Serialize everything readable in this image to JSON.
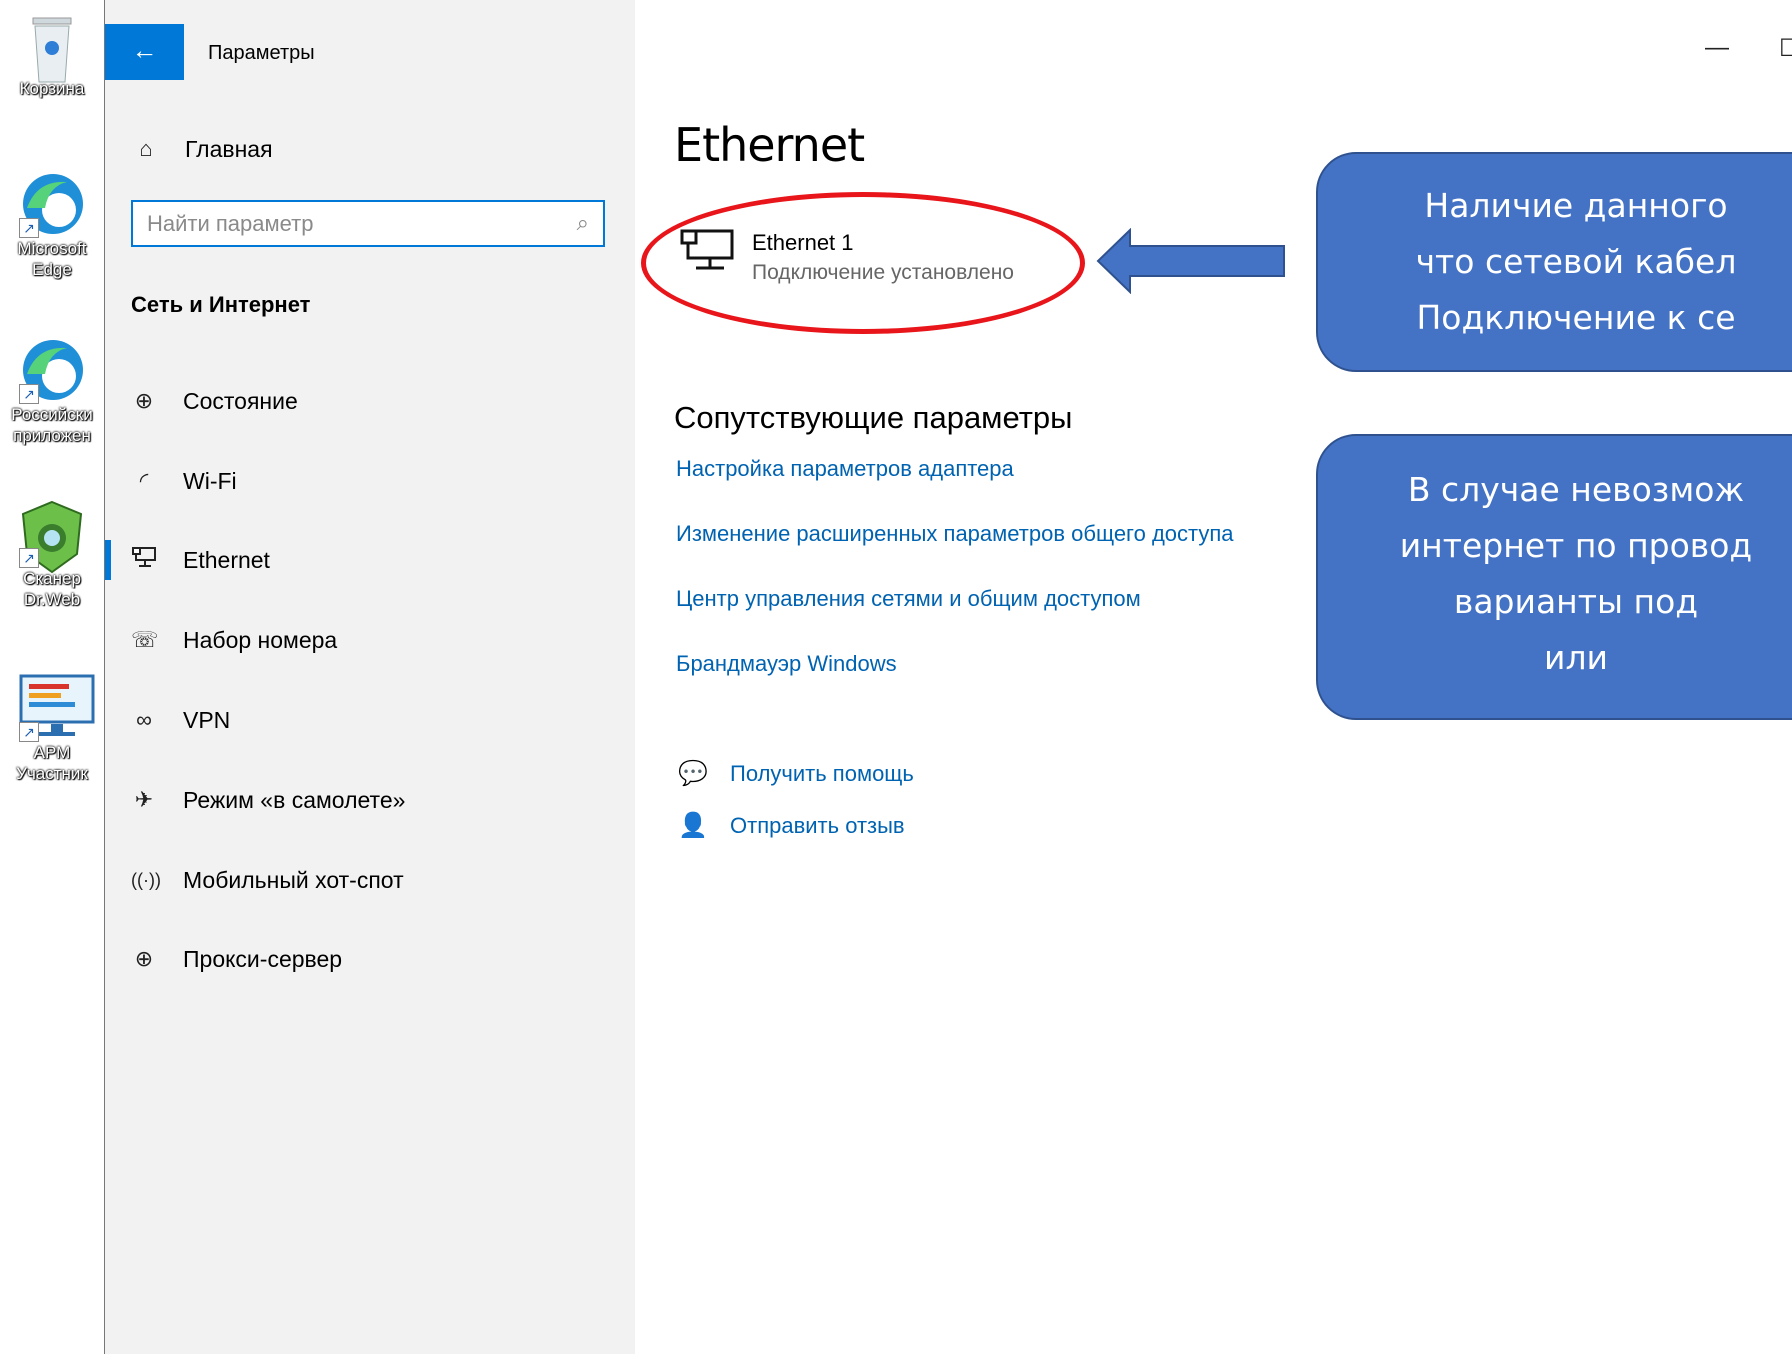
{
  "desktop": {
    "icons": [
      {
        "label_lines": [
          "Корзина"
        ]
      },
      {
        "label_lines": [
          "Microsoft",
          "Edge"
        ]
      },
      {
        "label_lines": [
          "Российски",
          "приложен"
        ]
      },
      {
        "label_lines": [
          "Сканер",
          "Dr.Web"
        ]
      },
      {
        "label_lines": [
          "АРМ",
          "Участник"
        ]
      }
    ]
  },
  "window": {
    "title": "Параметры",
    "controls": {
      "minimize": "—",
      "maximize": "☐",
      "close": "✕"
    }
  },
  "sidebar": {
    "home_label": "Главная",
    "search_placeholder": "Найти параметр",
    "section_title": "Сеть и Интернет",
    "items": [
      {
        "label": "Состояние",
        "icon": "globe-status-icon"
      },
      {
        "label": "Wi-Fi",
        "icon": "wifi-icon"
      },
      {
        "label": "Ethernet",
        "icon": "ethernet-icon",
        "selected": true
      },
      {
        "label": "Набор номера",
        "icon": "dialup-icon"
      },
      {
        "label": "VPN",
        "icon": "vpn-icon"
      },
      {
        "label": "Режим «в самолете»",
        "icon": "airplane-icon"
      },
      {
        "label": "Мобильный хот-спот",
        "icon": "hotspot-icon"
      },
      {
        "label": "Прокси-сервер",
        "icon": "proxy-globe-icon"
      }
    ]
  },
  "main": {
    "title": "Ethernet",
    "connection": {
      "name": "Ethernet 1",
      "status": "Подключение установлено"
    },
    "related_title": "Сопутствующие параметры",
    "related_links": [
      "Настройка параметров адаптера",
      "Изменение расширенных параметров общего доступа",
      "Центр управления сетями и общим доступом",
      "Брандмауэр Windows"
    ],
    "help_links": [
      "Получить помощь",
      "Отправить отзыв"
    ]
  },
  "annotations": {
    "callout1_lines": [
      "Наличие данного",
      "что сетевой кабел",
      "Подключение к се"
    ],
    "callout2_lines": [
      "В случае невозмож",
      "интернет по провод",
      "варианты под",
      "или"
    ],
    "colors": {
      "callout_fill": "#4472c4",
      "ellipse": "#e8151a",
      "accent": "#0078d7"
    }
  }
}
